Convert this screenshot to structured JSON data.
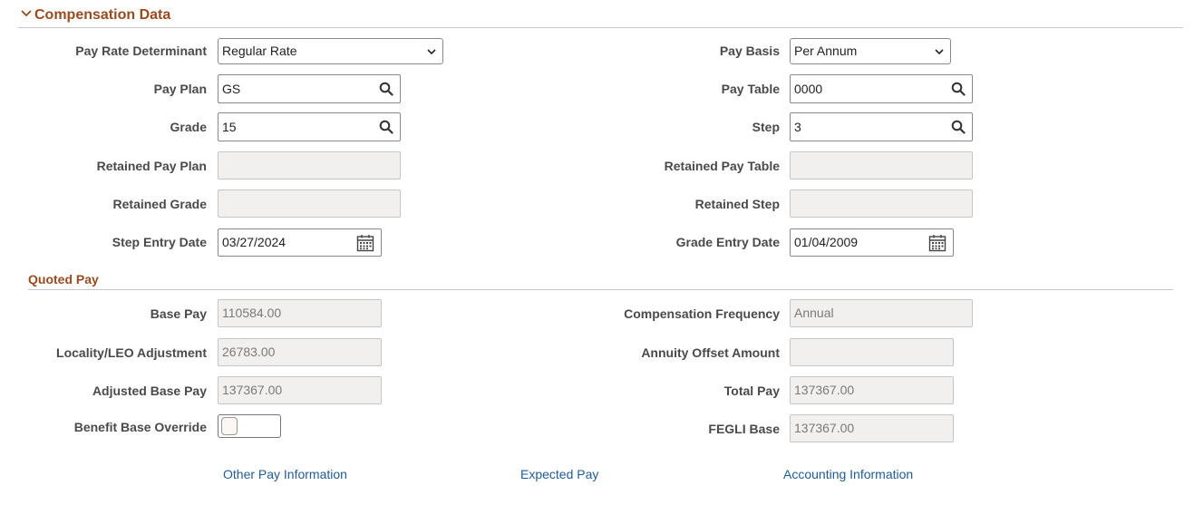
{
  "section": {
    "title": "Compensation Data"
  },
  "left_fields": {
    "pay_rate_determinant": {
      "label": "Pay Rate Determinant",
      "value": "Regular Rate"
    },
    "pay_plan": {
      "label": "Pay Plan",
      "value": "GS"
    },
    "grade": {
      "label": "Grade",
      "value": "15"
    },
    "retained_pay_plan": {
      "label": "Retained Pay Plan",
      "value": ""
    },
    "retained_grade": {
      "label": "Retained Grade",
      "value": ""
    },
    "step_entry_date": {
      "label": "Step Entry Date",
      "value": "03/27/2024"
    }
  },
  "right_fields": {
    "pay_basis": {
      "label": "Pay Basis",
      "value": "Per Annum"
    },
    "pay_table": {
      "label": "Pay Table",
      "value": "0000"
    },
    "step": {
      "label": "Step",
      "value": "3"
    },
    "retained_pay_table": {
      "label": "Retained Pay Table",
      "value": ""
    },
    "retained_step": {
      "label": "Retained Step",
      "value": ""
    },
    "grade_entry_date": {
      "label": "Grade Entry Date",
      "value": "01/04/2009"
    }
  },
  "quoted_pay": {
    "title": "Quoted Pay",
    "base_pay": {
      "label": "Base Pay",
      "value": "110584.00"
    },
    "locality_adjustment": {
      "label": "Locality/LEO Adjustment",
      "value": "26783.00"
    },
    "adjusted_base_pay": {
      "label": "Adjusted Base Pay",
      "value": "137367.00"
    },
    "benefit_base_override": {
      "label": "Benefit Base Override"
    },
    "compensation_frequency": {
      "label": "Compensation Frequency",
      "value": "Annual"
    },
    "annuity_offset_amount": {
      "label": "Annuity Offset Amount",
      "value": ""
    },
    "total_pay": {
      "label": "Total Pay",
      "value": "137367.00"
    },
    "fegli_base": {
      "label": "FEGLI Base",
      "value": "137367.00"
    }
  },
  "links": {
    "other_pay": "Other Pay Information",
    "expected_pay": "Expected Pay",
    "accounting": "Accounting Information"
  },
  "colors": {
    "section_title": "#9a4a1f",
    "link": "#1f5c99",
    "disabled_bg": "#f1f0ef"
  }
}
